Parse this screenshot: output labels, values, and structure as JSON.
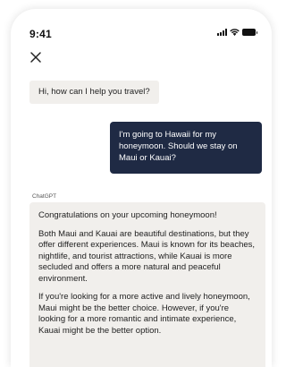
{
  "status_bar": {
    "time": "9:41",
    "icons": [
      "cellular-signal-icon",
      "wifi-icon",
      "battery-icon"
    ]
  },
  "header": {
    "close_icon": "close-icon"
  },
  "messages": [
    {
      "role": "assistant",
      "text": "Hi, how can I help you travel?"
    },
    {
      "role": "user",
      "text": "I'm going to Hawaii for my honeymoon. Should we stay on Maui or Kauai?"
    },
    {
      "role": "assistant",
      "sender": "ChatGPT",
      "paragraphs": [
        "Congratulations on your upcoming honeymoon!",
        "Both Maui and Kauai are beautiful destinations, but they offer different experiences. Maui is known for its beaches, nightlife, and tourist attractions, while Kauai is more secluded and offers a more natural and peaceful environment.",
        "If you're looking for a more active and lively honeymoon, Maui might be the better choice. However, if you're looking for a more romantic and intimate experience, Kauai might be the better option."
      ]
    }
  ],
  "colors": {
    "user_bubble": "#1f2a44",
    "assistant_bubble": "#f1efec",
    "text": "#222222"
  }
}
